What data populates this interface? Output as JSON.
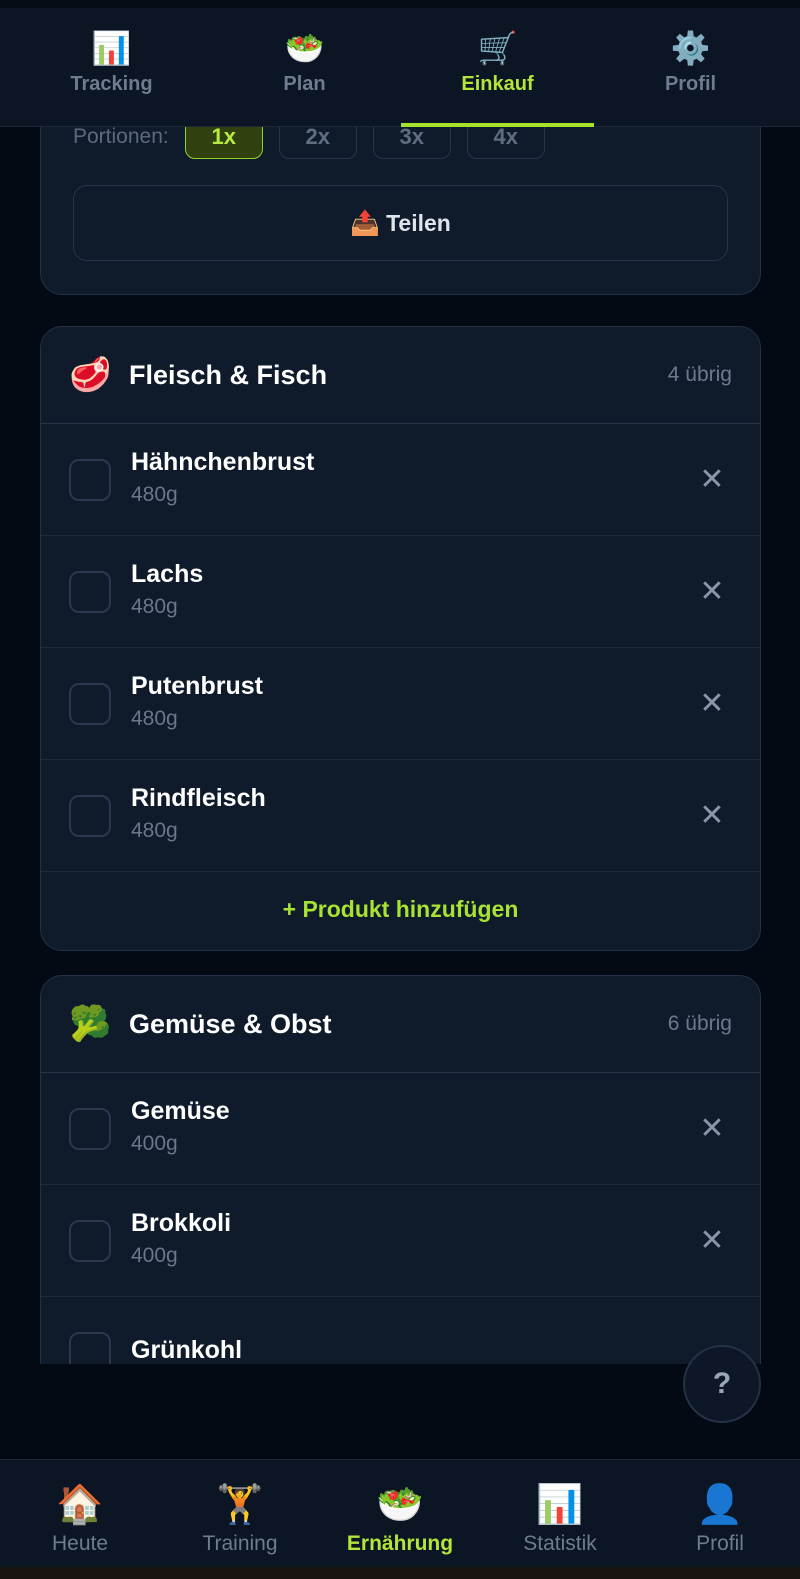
{
  "top_tabs": [
    {
      "label": "Tracking",
      "icon": "📊",
      "icon_name": "bar-chart-icon"
    },
    {
      "label": "Plan",
      "icon": "🥗",
      "icon_name": "salad-icon"
    },
    {
      "label": "Einkauf",
      "icon": "🛒",
      "icon_name": "shopping-cart-icon"
    },
    {
      "label": "Profil",
      "icon": "⚙️",
      "icon_name": "gear-icon"
    }
  ],
  "active_top_tab": "Einkauf",
  "portions": {
    "label": "Portionen:",
    "options": [
      "1x",
      "2x",
      "3x",
      "4x"
    ],
    "selected": "1x"
  },
  "share": {
    "icon": "📤",
    "label": "Teilen"
  },
  "categories": [
    {
      "icon": "🥩",
      "title": "Fleisch & Fisch",
      "remaining": "4 übrig",
      "items": [
        {
          "name": "Hähnchenbrust",
          "qty": "480g"
        },
        {
          "name": "Lachs",
          "qty": "480g"
        },
        {
          "name": "Putenbrust",
          "qty": "480g"
        },
        {
          "name": "Rindfleisch",
          "qty": "480g"
        }
      ],
      "add_label": "+ Produkt hinzufügen"
    },
    {
      "icon": "🥦",
      "title": "Gemüse & Obst",
      "remaining": "6 übrig",
      "items": [
        {
          "name": "Gemüse",
          "qty": "400g"
        },
        {
          "name": "Brokkoli",
          "qty": "400g"
        },
        {
          "name": "Grünkohl",
          "qty": ""
        }
      ]
    }
  ],
  "remove_symbol": "✕",
  "help_label": "?",
  "bottom_nav": [
    {
      "label": "Heute",
      "icon": "🏠",
      "icon_name": "home-icon"
    },
    {
      "label": "Training",
      "icon": "🏋️",
      "icon_name": "weightlifter-icon"
    },
    {
      "label": "Ernährung",
      "icon": "🥗",
      "icon_name": "salad-icon"
    },
    {
      "label": "Statistik",
      "icon": "📊",
      "icon_name": "bar-chart-icon"
    },
    {
      "label": "Profil",
      "icon": "👤",
      "icon_name": "user-icon"
    }
  ],
  "active_bottom_nav": "Ernährung",
  "colors": {
    "accent": "#a6e12e",
    "background": "#040a14",
    "card": "#0f1a2b"
  }
}
